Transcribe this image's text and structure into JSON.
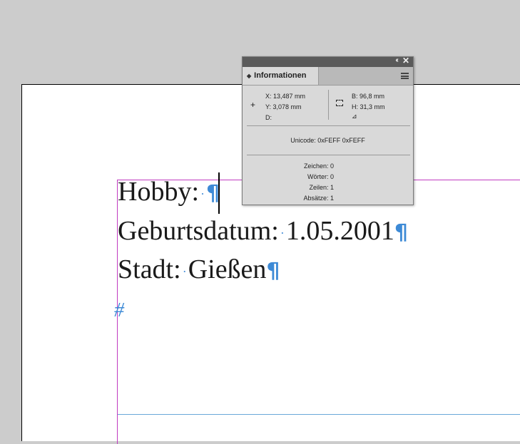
{
  "document": {
    "lines": [
      {
        "label": "Hobby:",
        "value": ""
      },
      {
        "label": "Geburtsdatum:",
        "value": "1.05.2001"
      },
      {
        "label": "Stadt:",
        "value": "Gießen"
      }
    ],
    "end_marker": "#"
  },
  "panel": {
    "tab_title": "Informationen",
    "x": "X: 13,487 mm",
    "y": "Y: 3,078 mm",
    "d": "D:",
    "b": "B: 96,8 mm",
    "h": "H: 31,3 mm",
    "unicode": "Unicode: 0xFEFF 0xFEFF",
    "counts": [
      {
        "label": "Zeichen:",
        "value": "0"
      },
      {
        "label": "Wörter:",
        "value": "0"
      },
      {
        "label": "Zeilen:",
        "value": "1"
      },
      {
        "label": "Absätze:",
        "value": "1"
      }
    ]
  },
  "colors": {
    "hidden_chars": "#3d8ad6",
    "frame": "#c03bc0",
    "canvas": "#cccccc"
  }
}
